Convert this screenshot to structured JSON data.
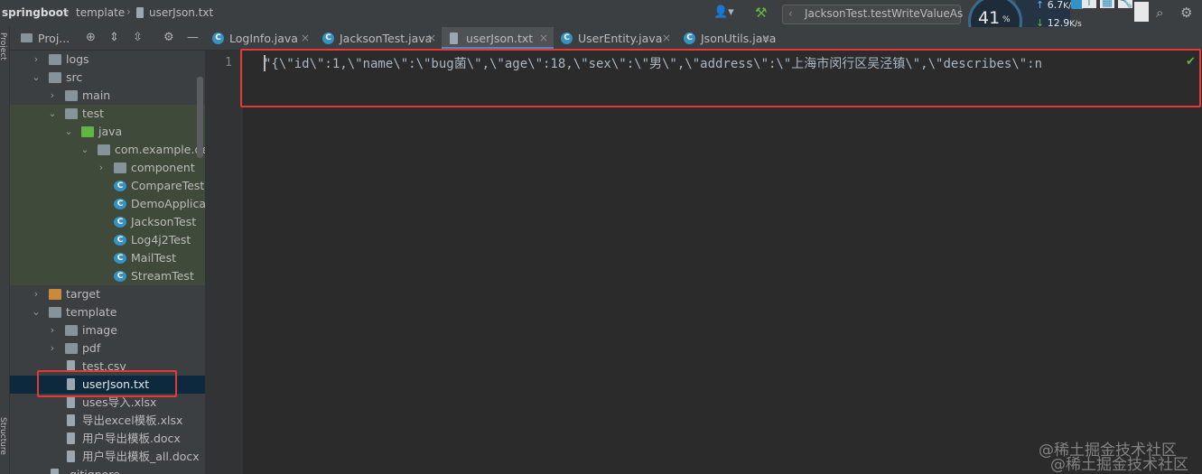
{
  "breadcrumb": {
    "project": "springboot",
    "folder": "template",
    "file": "userJson.txt"
  },
  "run_config": {
    "label": "JacksonTest.testWriteValueAs"
  },
  "monitor": {
    "cpu_percent": "41",
    "cpu_unit": "%",
    "upload": "6.7",
    "upload_unit": "K/s",
    "download": "12.9",
    "download_unit": "K/s"
  },
  "left_strip": {
    "project_label": "Project",
    "structure_label": "Structure"
  },
  "project_panel": {
    "title": "Proj..."
  },
  "tree": [
    {
      "label": "logs",
      "type": "folder",
      "arrow": "›",
      "indent": 1
    },
    {
      "label": "src",
      "type": "folder",
      "arrow": "⌄",
      "indent": 1
    },
    {
      "label": "main",
      "type": "folder",
      "arrow": "›",
      "indent": 2
    },
    {
      "label": "test",
      "type": "folder",
      "arrow": "⌄",
      "indent": 2
    },
    {
      "label": "java",
      "type": "folder-green",
      "arrow": "⌄",
      "indent": 3
    },
    {
      "label": "com.example.demo",
      "type": "package",
      "arrow": "⌄",
      "indent": 4
    },
    {
      "label": "component",
      "type": "package",
      "arrow": "›",
      "indent": 5
    },
    {
      "label": "CompareTest",
      "type": "class",
      "arrow": "",
      "indent": 5
    },
    {
      "label": "DemoApplicationTests",
      "type": "class",
      "arrow": "",
      "indent": 5
    },
    {
      "label": "JacksonTest",
      "type": "class",
      "arrow": "",
      "indent": 5
    },
    {
      "label": "Log4j2Test",
      "type": "class",
      "arrow": "",
      "indent": 5
    },
    {
      "label": "MailTest",
      "type": "class",
      "arrow": "",
      "indent": 5
    },
    {
      "label": "StreamTest",
      "type": "class",
      "arrow": "",
      "indent": 5
    },
    {
      "label": "target",
      "type": "folder-orange",
      "arrow": "›",
      "indent": 1
    },
    {
      "label": "template",
      "type": "folder",
      "arrow": "⌄",
      "indent": 1
    },
    {
      "label": "image",
      "type": "folder",
      "arrow": "›",
      "indent": 2
    },
    {
      "label": "pdf",
      "type": "folder",
      "arrow": "›",
      "indent": 2
    },
    {
      "label": "test.csv",
      "type": "file",
      "arrow": "",
      "indent": 2
    },
    {
      "label": "userJson.txt",
      "type": "file",
      "arrow": "",
      "indent": 2,
      "selected": true
    },
    {
      "label": "uses导入.xlsx",
      "type": "file",
      "arrow": "",
      "indent": 2
    },
    {
      "label": "导出excel模板.xlsx",
      "type": "file",
      "arrow": "",
      "indent": 2
    },
    {
      "label": "用户导出模板.docx",
      "type": "file",
      "arrow": "",
      "indent": 2
    },
    {
      "label": "用户导出模板_all.docx",
      "type": "file",
      "arrow": "",
      "indent": 2
    },
    {
      "label": ".gitignore",
      "type": "file",
      "arrow": "",
      "indent": 1
    }
  ],
  "tabs": [
    {
      "label": "LogInfo.java",
      "kind": "class",
      "active": false
    },
    {
      "label": "JacksonTest.java",
      "kind": "class",
      "active": false
    },
    {
      "label": "userJson.txt",
      "kind": "file",
      "active": true
    },
    {
      "label": "UserEntity.java",
      "kind": "class",
      "active": false
    },
    {
      "label": "JsonUtils.java",
      "kind": "class",
      "active": false
    }
  ],
  "editor": {
    "line_number": "1",
    "code": "\"{\\\"id\\\":1,\\\"name\\\":\\\"bug菌\\\",\\\"age\\\":18,\\\"sex\\\":\\\"男\\\",\\\"address\\\":\\\"上海市闵行区吴泾镇\\\",\\\"describes\\\":n"
  },
  "watermark": {
    "line1": "@稀土掘金技术社区",
    "line2": "@稀土掘金技术社区"
  },
  "colors": {
    "highlight_box": "#e53935",
    "selection": "#0d293e",
    "accent": "#4a88c7"
  }
}
